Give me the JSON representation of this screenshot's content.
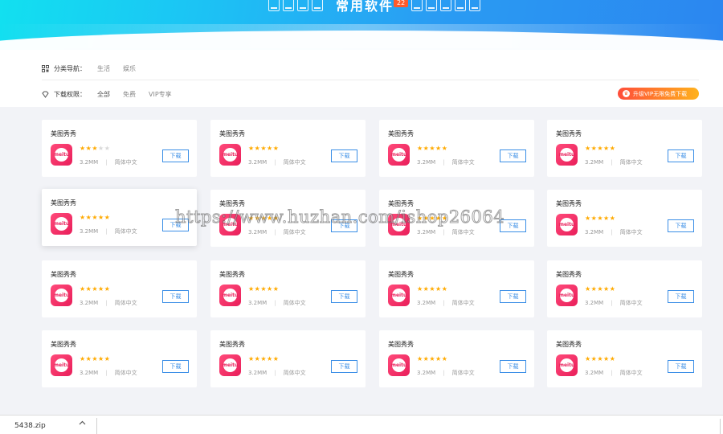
{
  "header": {
    "title": "常用软件",
    "count": "22"
  },
  "filters": {
    "category": {
      "label": "分类导航：",
      "options": [
        "生活",
        "娱乐"
      ]
    },
    "permission": {
      "label": "下载权限：",
      "options": [
        "全部",
        "免费",
        "VIP专享"
      ]
    },
    "vip_button": "升级VIP无限免费下载"
  },
  "cards": [
    {
      "name": "美图秀秀",
      "rating": 3,
      "size": "3.2MM",
      "lang": "简体中文",
      "button": "下载"
    },
    {
      "name": "美图秀秀",
      "rating": 5,
      "size": "3.2MM",
      "lang": "简体中文",
      "button": "下载"
    },
    {
      "name": "美图秀秀",
      "rating": 5,
      "size": "3.2MM",
      "lang": "简体中文",
      "button": "下载"
    },
    {
      "name": "美图秀秀",
      "rating": 5,
      "size": "3.2MM",
      "lang": "简体中文",
      "button": "下载"
    },
    {
      "name": "美图秀秀",
      "rating": 5,
      "size": "3.2MM",
      "lang": "简体中文",
      "button": "下载"
    },
    {
      "name": "美图秀秀",
      "rating": 5,
      "size": "3.2MM",
      "lang": "简体中文",
      "button": "下载"
    },
    {
      "name": "美图秀秀",
      "rating": 5,
      "size": "3.2MM",
      "lang": "简体中文",
      "button": "下载"
    },
    {
      "name": "美图秀秀",
      "rating": 5,
      "size": "3.2MM",
      "lang": "简体中文",
      "button": "下载"
    },
    {
      "name": "美图秀秀",
      "rating": 5,
      "size": "3.2MM",
      "lang": "简体中文",
      "button": "下载"
    },
    {
      "name": "美图秀秀",
      "rating": 5,
      "size": "3.2MM",
      "lang": "简体中文",
      "button": "下载"
    },
    {
      "name": "美图秀秀",
      "rating": 5,
      "size": "3.2MM",
      "lang": "简体中文",
      "button": "下载"
    },
    {
      "name": "美图秀秀",
      "rating": 5,
      "size": "3.2MM",
      "lang": "简体中文",
      "button": "下载"
    },
    {
      "name": "美图秀秀",
      "rating": 5,
      "size": "3.2MM",
      "lang": "简体中文",
      "button": "下载"
    },
    {
      "name": "美图秀秀",
      "rating": 5,
      "size": "3.2MM",
      "lang": "简体中文",
      "button": "下载"
    },
    {
      "name": "美图秀秀",
      "rating": 5,
      "size": "3.2MM",
      "lang": "简体中文",
      "button": "下载"
    },
    {
      "name": "美图秀秀",
      "rating": 5,
      "size": "3.2MM",
      "lang": "简体中文",
      "button": "下载"
    }
  ],
  "app_icon_text": "meitu",
  "watermark": "https://www.huzhan.com/ishop26064",
  "download_bar": {
    "filename": "5438.zip"
  },
  "icons": {
    "category": "grid-icon",
    "permission": "diamond-icon",
    "vip": "crown-icon",
    "expand": "chevron-up-icon"
  },
  "colors": {
    "banner_start": "#12e0f0",
    "banner_end": "#2b86f0",
    "accent_blue": "#3a8ee6",
    "star": "#ffaa00",
    "vip_start": "#ff4d3a",
    "vip_end": "#ffb21c"
  }
}
